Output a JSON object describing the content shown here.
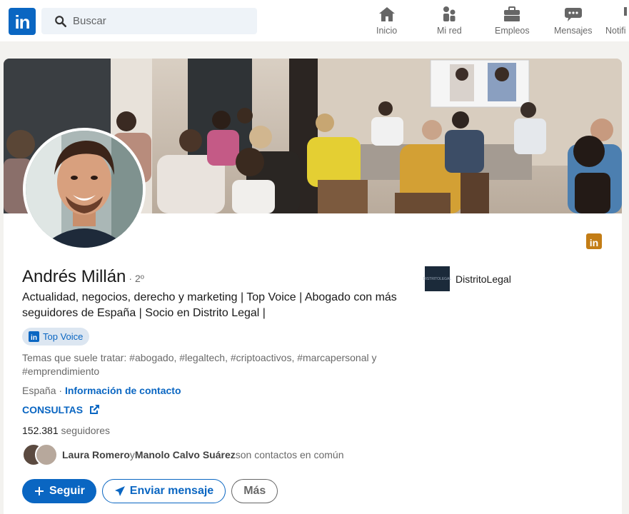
{
  "nav": {
    "logo_text": "in",
    "search_placeholder": "Buscar",
    "items": [
      {
        "label": "Inicio",
        "icon": "home-icon"
      },
      {
        "label": "Mi red",
        "icon": "people-icon"
      },
      {
        "label": "Empleos",
        "icon": "briefcase-icon"
      },
      {
        "label": "Mensajes",
        "icon": "chat-icon"
      },
      {
        "label": "Notifi",
        "icon": "bell-icon"
      }
    ]
  },
  "profile": {
    "name": "Andrés Millán",
    "degree": "· 2º",
    "headline": "Actualidad, negocios, derecho y marketing | Top Voice | Abogado con más seguidores de España | Socio en Distrito Legal |",
    "top_voice_logo": "in",
    "top_voice": "Top Voice",
    "themes": "Temas que suele tratar: #abogado, #legaltech, #criptoactivos, #marcapersonal y #emprendimiento",
    "location": "España",
    "location_separator": " · ",
    "contact_link": "Información de contacto",
    "website_label": "CONSULTAS",
    "followers_count": "152.381",
    "followers_label": " seguidores",
    "mutual": {
      "name1": "Laura Romero",
      "connector": " y ",
      "name2": "Manolo Calvo Suárez",
      "suffix": " son contactos en común"
    },
    "company": {
      "name": "DistritoLegal",
      "logo_text": "DISTRITOLEGAL"
    }
  },
  "actions": {
    "follow": "Seguir",
    "message": "Enviar mensaje",
    "more": "Más"
  },
  "colors": {
    "brand": "#0a66c2",
    "premium_gold": "#c37d16"
  }
}
